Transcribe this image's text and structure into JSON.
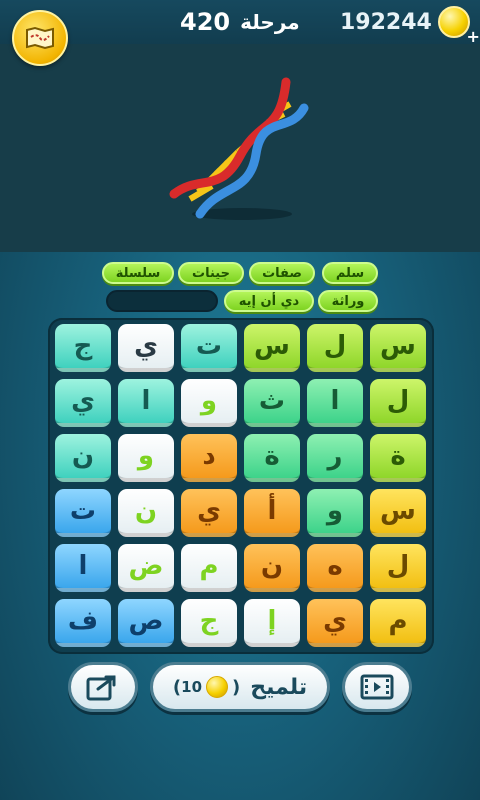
{
  "header": {
    "level_word": "مرحلة",
    "level_number": "420",
    "coins": "192244",
    "plus": "+",
    "map_icon": "map-icon",
    "coin_icon": "coin-icon"
  },
  "picture": {
    "subject_icon": "dna-icon"
  },
  "answers": {
    "row1": [
      "سلم",
      "صفات",
      "جينات",
      "سلسلة"
    ],
    "row2": [
      "وراثة",
      "دي أن إيه"
    ]
  },
  "grid": {
    "rows": [
      [
        "س",
        "ل",
        "س",
        "ت",
        "ي",
        "ج"
      ],
      [
        "ل",
        "ا",
        "ث",
        "و",
        "ا",
        "ي"
      ],
      [
        "ة",
        "ر",
        "ة",
        "د",
        "و",
        "ن"
      ],
      [
        "س",
        "و",
        "أ",
        "ي",
        "ن",
        "ت"
      ],
      [
        "ل",
        "ه",
        "ن",
        "م",
        "ض",
        "ا"
      ],
      [
        "م",
        "ي",
        "إ",
        "ج",
        "ص",
        "ف"
      ]
    ]
  },
  "bottom": {
    "hint_label": "تلميح",
    "hint_cost": "10",
    "hint_open_paren": "(",
    "hint_close_paren": ")",
    "share_icon": "share-icon",
    "video_icon": "video-icon"
  },
  "colors": {
    "green": "#8fd62a",
    "mint": "#3dd38a",
    "teal": "#3fd1be",
    "white": "#ffffff",
    "orange": "#f59a1c",
    "blue": "#3aa6ec",
    "yellow": "#f2bf12"
  }
}
